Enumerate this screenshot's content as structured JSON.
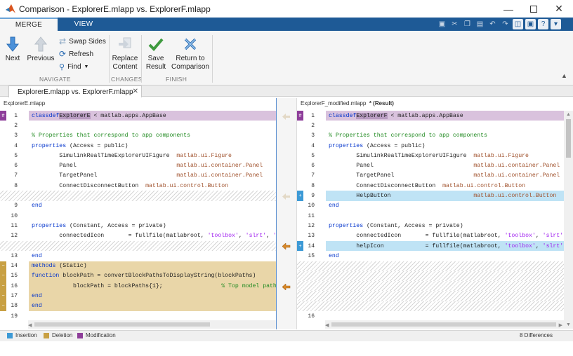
{
  "window": {
    "title": "Comparison - ExplorerE.mlapp vs. ExplorerF.mlapp"
  },
  "ribbon_tabs": [
    {
      "label": "MERGE"
    },
    {
      "label": "VIEW"
    }
  ],
  "navigate": {
    "next": "Next",
    "previous": "Previous",
    "swap": "Swap Sides",
    "refresh": "Refresh",
    "find": "Find",
    "group": "NAVIGATE"
  },
  "changes": {
    "replace": [
      "Replace",
      "Content"
    ],
    "group": "CHANGES"
  },
  "finish": {
    "save": [
      "Save",
      "Result"
    ],
    "return": [
      "Return to",
      "Comparison"
    ],
    "group": "FINISH"
  },
  "doc_tab": {
    "label": "ExplorerE.mlapp vs. ExplorerF.mlapp"
  },
  "left": {
    "header": "ExplorerE.mlapp",
    "lines": [
      {
        "n": "1",
        "t": "mod",
        "html": "<span class=\"kw\">classdef</span> ExplorerE &lt; matlab.apps.AppBase"
      },
      {
        "n": "2",
        "t": "",
        "html": ""
      },
      {
        "n": "3",
        "t": "",
        "html": "    <span class=\"com\">% Properties that correspond to app components</span>"
      },
      {
        "n": "4",
        "t": "",
        "html": "    <span class=\"kw\">properties</span> (Access = public)"
      },
      {
        "n": "5",
        "t": "",
        "html": "        SimulinkRealTimeExplorerUIFigure  <span class=\"typ\">matlab.ui.Figure</span>"
      },
      {
        "n": "6",
        "t": "",
        "html": "        Panel                             <span class=\"typ\">matlab.ui.container.Panel</span>"
      },
      {
        "n": "7",
        "t": "",
        "html": "        TargetPanel                       <span class=\"typ\">matlab.ui.container.Panel</span>"
      },
      {
        "n": "8",
        "t": "",
        "html": "        ConnectDisconnectButton  <span class=\"typ\">matlab.ui.control.Button</span>"
      },
      {
        "n": "",
        "t": "hatch",
        "html": ""
      },
      {
        "n": "9",
        "t": "",
        "html": "    <span class=\"kw\">end</span>"
      },
      {
        "n": "10",
        "t": "",
        "html": ""
      },
      {
        "n": "11",
        "t": "",
        "html": "    <span class=\"kw\">properties</span> (Constant, Access = private)"
      },
      {
        "n": "12",
        "t": "",
        "html": "        connectedIcon       = fullfile(matlabroot, <span class=\"str\">'toolbox'</span>, <span class=\"str\">'slrt'</span>, <span class=\"str\">'slrt</span>"
      },
      {
        "n": "",
        "t": "hatch",
        "html": ""
      },
      {
        "n": "13",
        "t": "",
        "html": "    <span class=\"kw\">end</span>"
      },
      {
        "n": "14",
        "t": "del",
        "html": "    <span class=\"kw\">methods</span> (Static)"
      },
      {
        "n": "15",
        "t": "del",
        "html": "        <span class=\"kw\">function</span> blockPath = convertBlockPathsToDisplayString(blockPaths)"
      },
      {
        "n": "16",
        "t": "del",
        "html": "            blockPath = blockPaths{1};                 <span class=\"com\">% Top model path</span>"
      },
      {
        "n": "17",
        "t": "del",
        "html": "        <span class=\"kw\">end</span>"
      },
      {
        "n": "18",
        "t": "del",
        "html": "    <span class=\"kw\">end</span>"
      },
      {
        "n": "19",
        "t": "",
        "html": ""
      }
    ]
  },
  "right": {
    "header": "ExplorerF_modified.mlapp",
    "result": "* (Result)",
    "lines": [
      {
        "n": "1",
        "t": "mod",
        "html": "<span class=\"kw\">classdef</span> ExplorerF &lt; matlab.apps.AppBase"
      },
      {
        "n": "2",
        "t": "",
        "html": ""
      },
      {
        "n": "3",
        "t": "",
        "html": "    <span class=\"com\">% Properties that correspond to app components</span>"
      },
      {
        "n": "4",
        "t": "",
        "html": "    <span class=\"kw\">properties</span> (Access = public)"
      },
      {
        "n": "5",
        "t": "",
        "html": "        SimulinkRealTimeExplorerUIFigure  <span class=\"typ\">matlab.ui.Figure</span>"
      },
      {
        "n": "6",
        "t": "",
        "html": "        Panel                             <span class=\"typ\">matlab.ui.container.Panel</span>"
      },
      {
        "n": "7",
        "t": "",
        "html": "        TargetPanel                       <span class=\"typ\">matlab.ui.container.Panel</span>"
      },
      {
        "n": "8",
        "t": "",
        "html": "        ConnectDisconnectButton  <span class=\"typ\">matlab.ui.control.Button</span>"
      },
      {
        "n": "9",
        "t": "ins",
        "html": "        HelpButton                        <span class=\"typ\">matlab.ui.control.Button</span>"
      },
      {
        "n": "10",
        "t": "",
        "html": "    <span class=\"kw\">end</span>"
      },
      {
        "n": "11",
        "t": "",
        "html": ""
      },
      {
        "n": "12",
        "t": "",
        "html": "    <span class=\"kw\">properties</span> (Constant, Access = private)"
      },
      {
        "n": "13",
        "t": "",
        "html": "        connectedIcon       = fullfile(matlabroot, <span class=\"str\">'toolbox'</span>, <span class=\"str\">'slrt'</span>, <span class=\"str\">'sl</span>"
      },
      {
        "n": "14",
        "t": "ins",
        "html": "        helpIcon            = fullfile(matlabroot, <span class=\"str\">'toolbox'</span>, <span class=\"str\">'slrt'</span>, <span class=\"str\">'s</span>"
      },
      {
        "n": "15",
        "t": "",
        "html": "    <span class=\"kw\">end</span>"
      },
      {
        "n": "",
        "t": "hatch",
        "html": ""
      },
      {
        "n": "",
        "t": "hatch",
        "html": ""
      },
      {
        "n": "",
        "t": "hatch",
        "html": ""
      },
      {
        "n": "",
        "t": "hatch",
        "html": ""
      },
      {
        "n": "",
        "t": "hatch",
        "html": ""
      },
      {
        "n": "16",
        "t": "",
        "html": ""
      }
    ]
  },
  "legend": {
    "insertion": "Insertion",
    "deletion": "Deletion",
    "modification": "Modification",
    "differences": "8 Differences"
  },
  "colors": {
    "insertion": "#bfe3f5",
    "deletion": "#e9d6a8",
    "modification": "#d9c2dd",
    "tab_bar": "#1e5a96"
  }
}
